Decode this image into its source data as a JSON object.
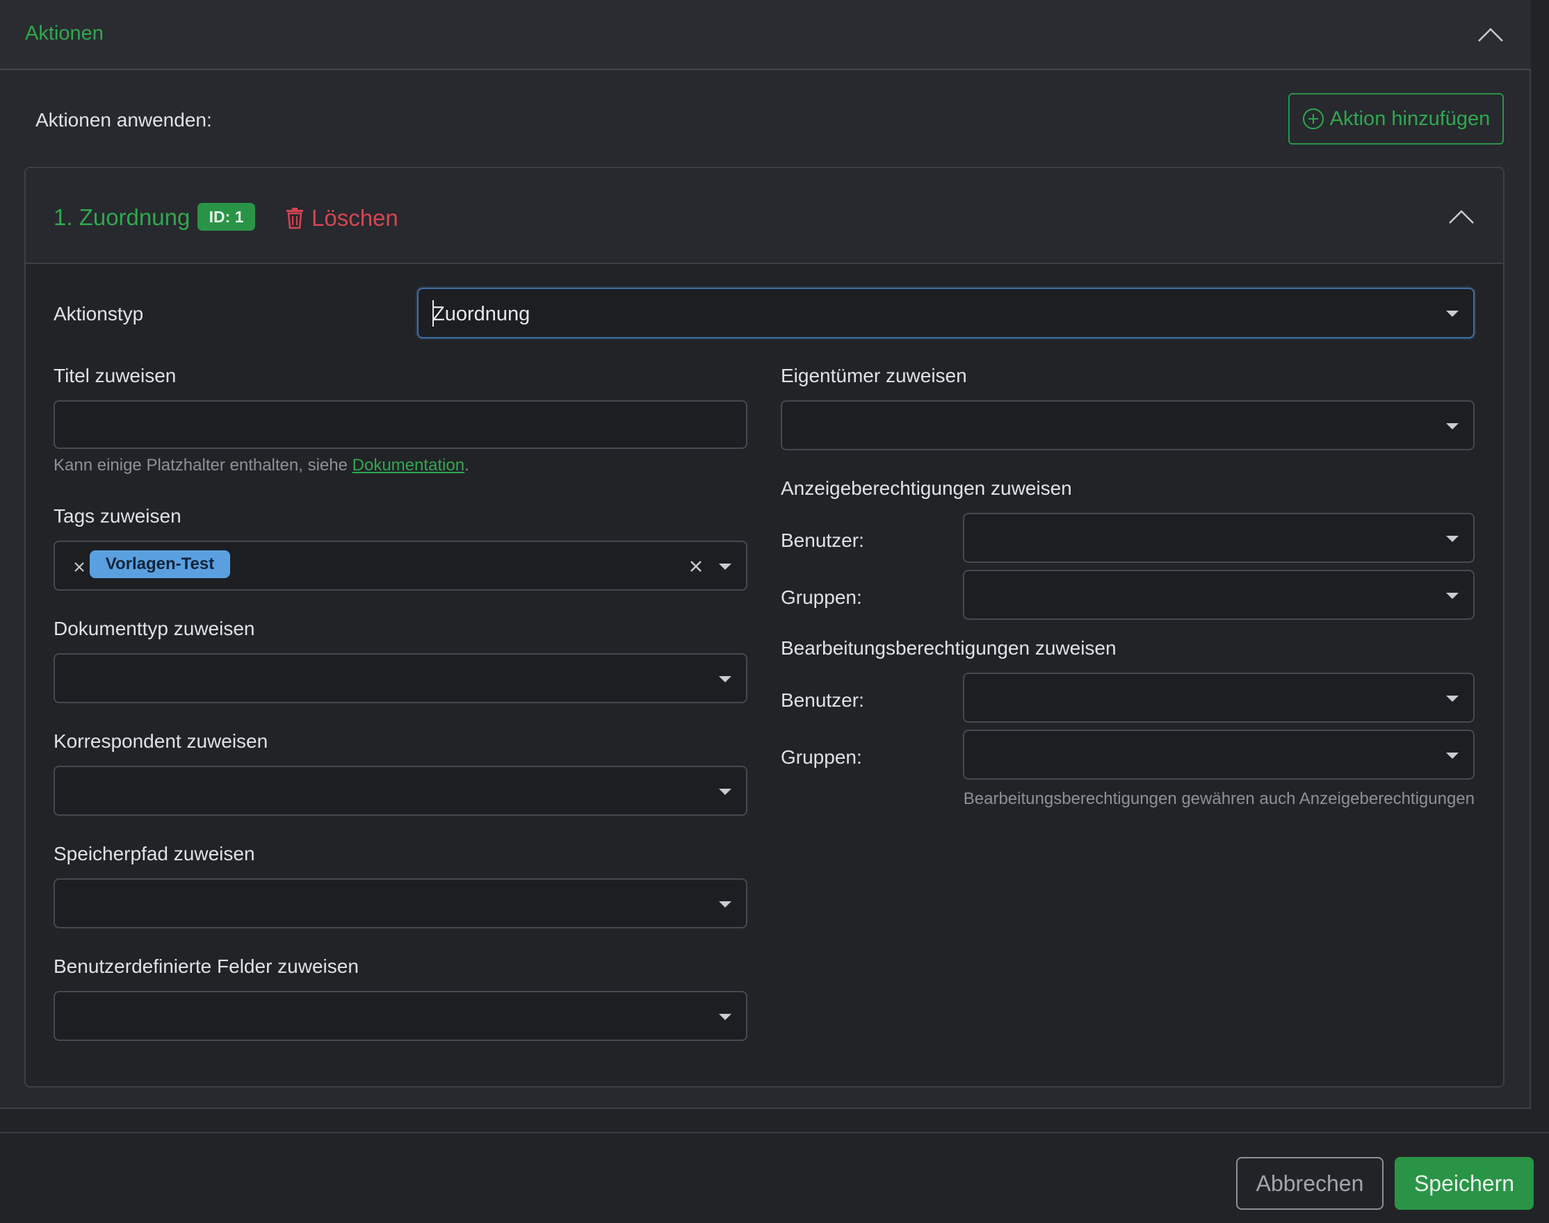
{
  "section": {
    "title": "Aktionen",
    "apply_label": "Aktionen anwenden:",
    "add_action_label": "Aktion hinzufügen"
  },
  "action": {
    "title": "1. Zuordnung",
    "id_badge": "ID: 1",
    "delete_label": "Löschen"
  },
  "form": {
    "action_type_label": "Aktionstyp",
    "action_type_value": "Zuordnung",
    "title_label": "Titel zuweisen",
    "title_value": "",
    "title_hint_prefix": "Kann einige Platzhalter enthalten, siehe ",
    "title_hint_link": "Dokumentation",
    "title_hint_suffix": ".",
    "tags_label": "Tags zuweisen",
    "tags": [
      "Vorlagen-Test"
    ],
    "doctype_label": "Dokumenttyp zuweisen",
    "correspondent_label": "Korrespondent zuweisen",
    "storage_path_label": "Speicherpfad zuweisen",
    "custom_fields_label": "Benutzerdefinierte Felder zuweisen",
    "owner_label": "Eigentümer zuweisen",
    "view_perms_label": "Anzeigeberechtigungen zuweisen",
    "edit_perms_label": "Bearbeitungsberechtigungen zuweisen",
    "users_label": "Benutzer:",
    "groups_label": "Gruppen:",
    "edit_perms_hint": "Bearbeitungsberechtigungen gewähren auch Anzeigeberechtigungen"
  },
  "footer": {
    "cancel_label": "Abbrechen",
    "save_label": "Speichern"
  },
  "colors": {
    "accent_green": "#2fa84f",
    "danger_red": "#d64553",
    "tag_blue": "#5aa0e0"
  }
}
